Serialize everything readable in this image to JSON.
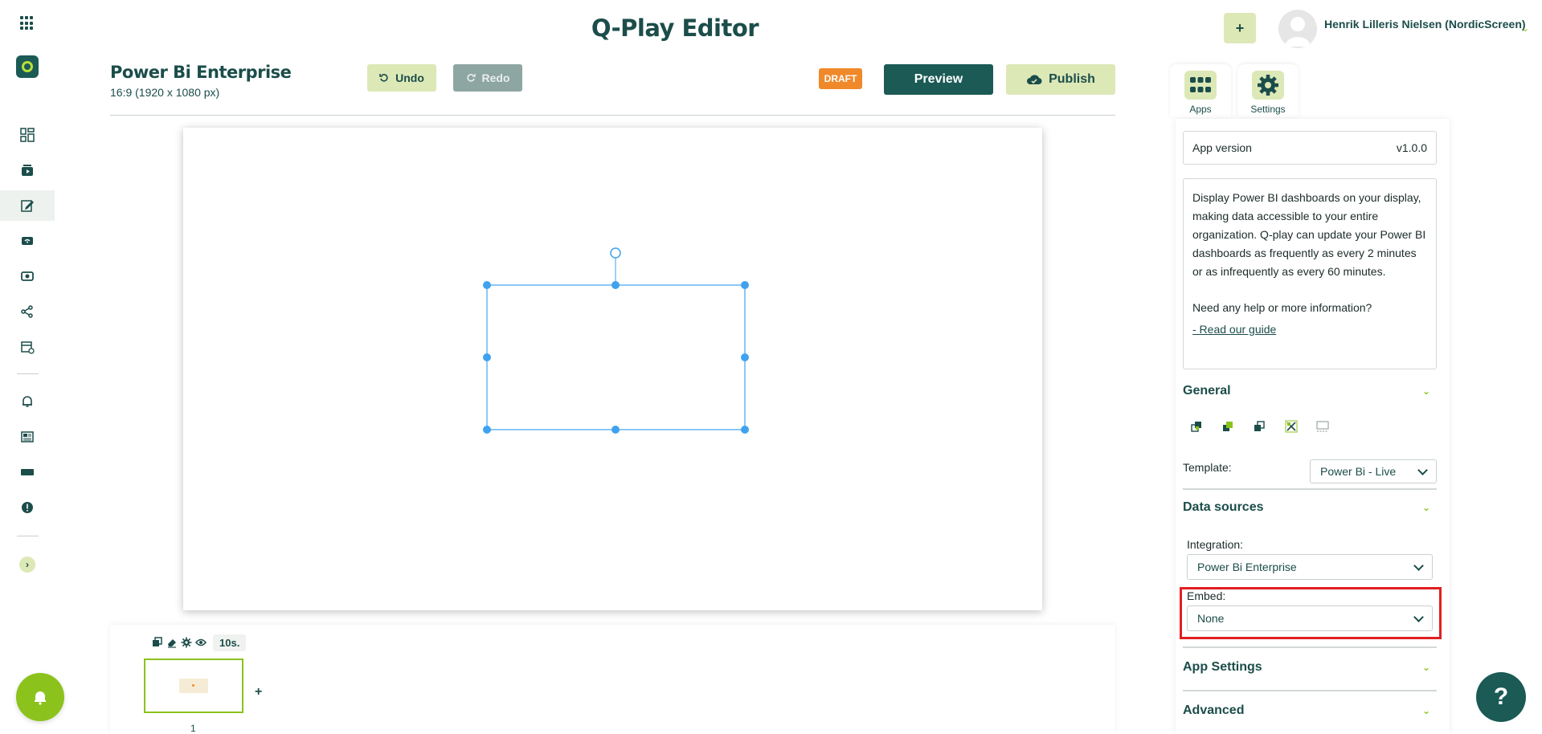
{
  "app": {
    "title": "Q-Play Editor"
  },
  "user": {
    "name": "Henrik Lilleris Nielsen (NordicScreen)"
  },
  "header": {
    "add_label": "+"
  },
  "project": {
    "name": "Power Bi Enterprise",
    "resolution": "16:9 (1920 x 1080 px)"
  },
  "toolbar": {
    "undo_label": "Undo",
    "redo_label": "Redo",
    "status_badge": "DRAFT",
    "preview_label": "Preview",
    "publish_label": "Publish"
  },
  "timeline": {
    "duration": "10s.",
    "add_label": "+",
    "slide_number": "1"
  },
  "tabs": [
    {
      "label": "Apps"
    },
    {
      "label": "Settings"
    }
  ],
  "panel": {
    "version_label": "App version",
    "version_value": "v1.0.0",
    "description": "Display Power BI dashboards on your display, making data accessible to your entire organization. Q-play can update your Power BI dashboards as frequently as every 2 minutes or as infrequently as every 60 minutes.",
    "help_text": "Need any help or more information?",
    "guide_link": "- Read our guide",
    "sections": {
      "general": "General",
      "data_sources": "Data sources",
      "app_settings": "App Settings",
      "advanced": "Advanced"
    },
    "template": {
      "label": "Template:",
      "value": "Power Bi - Live"
    },
    "integration": {
      "label": "Integration:",
      "value": "Power Bi Enterprise"
    },
    "embed": {
      "label": "Embed:",
      "value": "None"
    }
  },
  "help": {
    "label": "?"
  },
  "colors": {
    "brand_dark": "#1b5a55",
    "brand_light": "#dde8b7",
    "accent_green": "#8cc21c",
    "draft_orange": "#f0892a",
    "selection_blue": "#3fa2f0",
    "highlight_red": "#e02020"
  }
}
